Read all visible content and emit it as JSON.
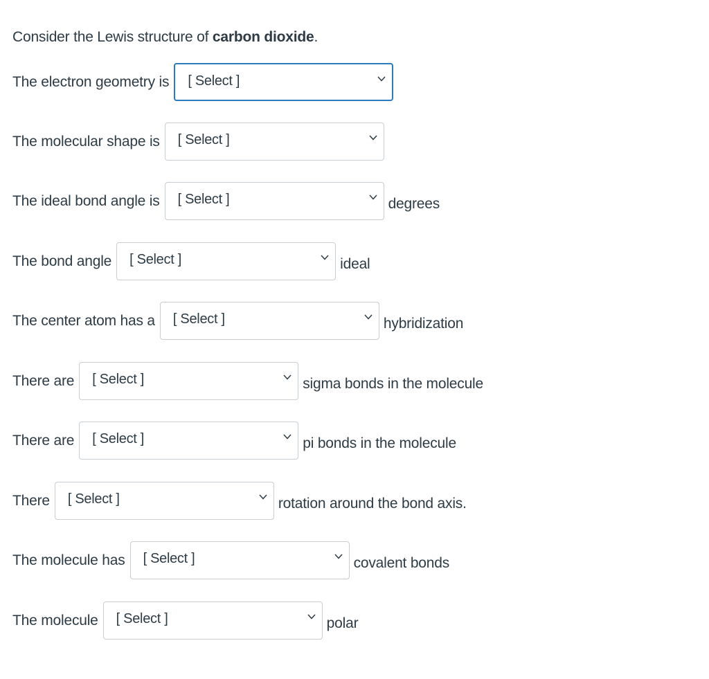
{
  "intro": {
    "prefix": "Consider the Lewis structure of ",
    "bold": "carbon dioxide",
    "suffix": "."
  },
  "rows": [
    {
      "pre": "The electron geometry is",
      "select": "[ Select ]",
      "post": "",
      "focused": true
    },
    {
      "pre": "The molecular shape is",
      "select": "[ Select ]",
      "post": ""
    },
    {
      "pre": "The ideal bond angle is",
      "select": "[ Select ]",
      "post": "degrees"
    },
    {
      "pre": "The bond angle",
      "select": "[ Select ]",
      "post": "ideal"
    },
    {
      "pre": "The center atom has a",
      "select": "[ Select ]",
      "post": "hybridization"
    },
    {
      "pre": "There are",
      "select": "[ Select ]",
      "post": "sigma bonds in the molecule"
    },
    {
      "pre": "There are",
      "select": "[ Select ]",
      "post": "pi bonds in the molecule"
    },
    {
      "pre": "There",
      "select": "[ Select ]",
      "post": "rotation around the bond axis."
    },
    {
      "pre": "The molecule has",
      "select": "[ Select ]",
      "post": "covalent bonds"
    },
    {
      "pre": "The molecule",
      "select": "[ Select ]",
      "post": "polar"
    }
  ],
  "icons": {
    "dropdown": "chevron-down-icon"
  },
  "colors": {
    "text": "#2d3b45",
    "focus_border": "#2b7abc",
    "border": "#c7cdd1"
  }
}
